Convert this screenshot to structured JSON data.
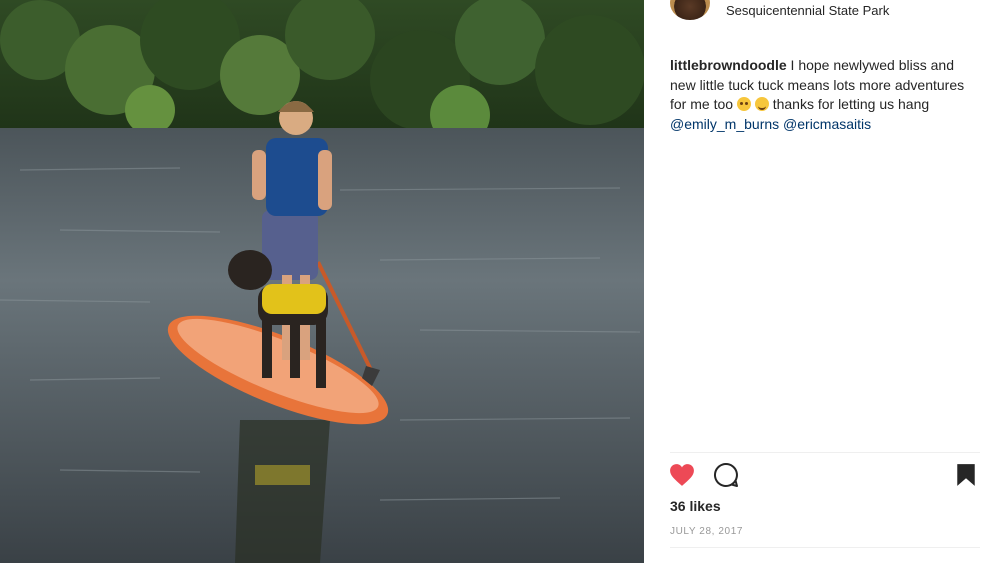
{
  "post": {
    "location": "Sesquicentennial State Park",
    "username": "littlebrowndoodle",
    "caption_part1": "I hope newlywed bliss and new little tuck tuck means lots more adventures for me too",
    "caption_part2": "thanks for letting us hang",
    "mention_1": "@emily_m_burns",
    "mention_2": "@ericmasaitis",
    "likes": "36 likes",
    "date": "JULY 28, 2017",
    "image_alt": "Woman on orange paddle board with a dog in a yellow life vest on a lake"
  },
  "icons": {
    "like": "heart-icon",
    "comment": "comment-icon",
    "save": "bookmark-icon"
  },
  "colors": {
    "like_active": "#ed4956",
    "text": "#262626",
    "mention": "#003569",
    "muted": "#999999"
  }
}
